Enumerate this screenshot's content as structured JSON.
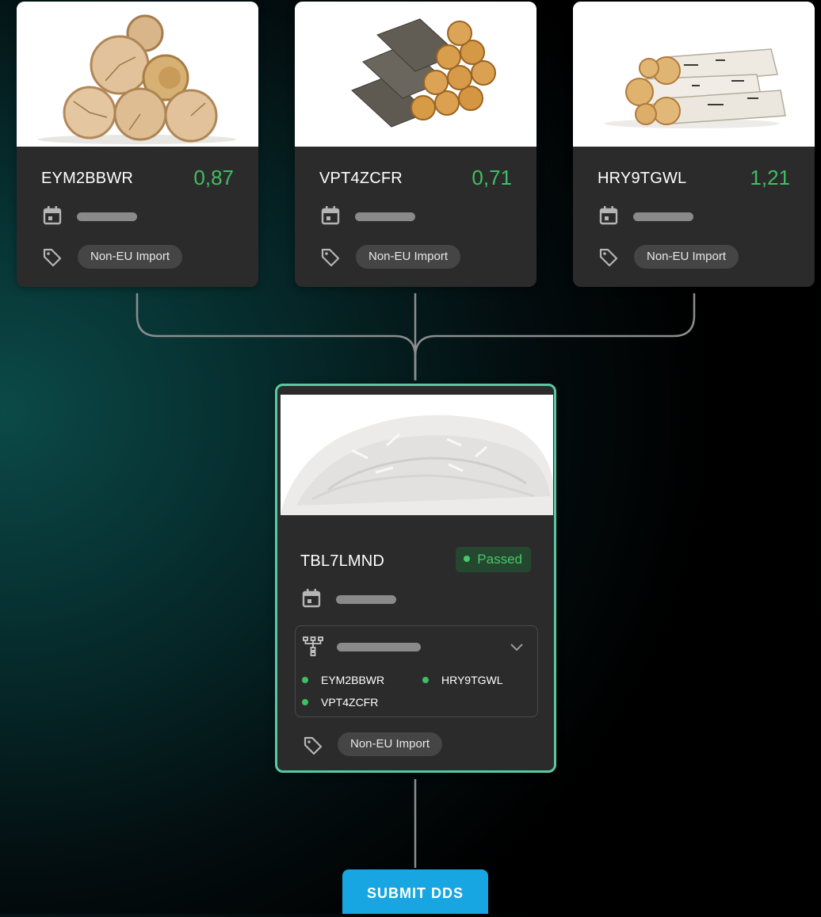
{
  "source_lots": [
    {
      "code": "EYM2BBWR",
      "score": "0,87",
      "tag": "Non-EU Import",
      "image": "round-log-pile"
    },
    {
      "code": "VPT4ZCFR",
      "score": "0,71",
      "tag": "Non-EU Import",
      "image": "bark-log-stack"
    },
    {
      "code": "HRY9TGWL",
      "score": "1,21",
      "tag": "Non-EU Import",
      "image": "birch-log-stack"
    }
  ],
  "output_lot": {
    "code": "TBL7LMND",
    "status": "Passed",
    "image": "white-fiber-pile",
    "origins": [
      "EYM2BBWR",
      "HRY9TGWL",
      "VPT4ZCFR"
    ],
    "tag": "Non-EU Import"
  },
  "actions": {
    "submit_label": "SUBMIT DDS"
  },
  "colors": {
    "score": "#3fbf63",
    "passed": "#45c76a",
    "output_border": "#5ac9a3",
    "submit": "#17a6e2",
    "card": "#2b2b2b"
  },
  "icons": [
    "calendar-icon",
    "tag-icon",
    "hierarchy-icon",
    "chevron-down-icon",
    "status-dot-icon"
  ]
}
